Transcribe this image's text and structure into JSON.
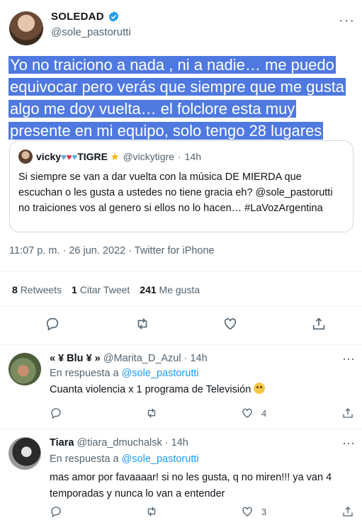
{
  "tweet": {
    "display_name": "SOLEDAD",
    "handle": "@sole_pastorutti",
    "text": "Yo no traiciono a nada , ni a nadie… me puedo equivocar pero verás que siempre que me gusta algo me doy vuelta… el folclore esta muy presente en mi equipo, solo  tengo 28 lugares",
    "timestamp": "11:07 p. m. · 26 jun. 2022 · Twitter for iPhone"
  },
  "quote": {
    "name_prefix": "vicky",
    "name_suffix": "TIGRE",
    "handle": "@vickytigre",
    "dot": "·",
    "time": "14h",
    "text": "Si siempre se van a dar vuelta con la música DE MIERDA que escuchan o les gusta a ustedes no tiene gracia eh? @sole_pastorutti no traiciones vos al genero si ellos no lo hacen… #LaVozArgentina"
  },
  "stats": {
    "retweets_count": "8",
    "retweets_label": "Retweets",
    "quotes_count": "1",
    "quotes_label": "Citar Tweet",
    "likes_count": "241",
    "likes_label": "Me gusta"
  },
  "replies": [
    {
      "name": "« ¥ Blu ¥ »",
      "handle": "@Marita_D_Azul",
      "time": "· 14h",
      "in_reply_prefix": "En respuesta a",
      "in_reply_mention": "@sole_pastorutti",
      "text": "Cuanta violencia x 1 programa de Televisión",
      "likes": "4"
    },
    {
      "name": "Tiara",
      "handle": "@tiara_dmuchalsk",
      "time": "· 14h",
      "in_reply_prefix": "En respuesta a",
      "in_reply_mention": "@sole_pastorutti",
      "text": "mas amor por favaaaar! si no les gusta, q no miren!!! ya van 4 temporadas y nunca lo van a entender",
      "likes": "3"
    }
  ],
  "colors": {
    "highlight": "#4f79e0",
    "accent": "#1d9bf0",
    "secondary_text": "#536471"
  }
}
